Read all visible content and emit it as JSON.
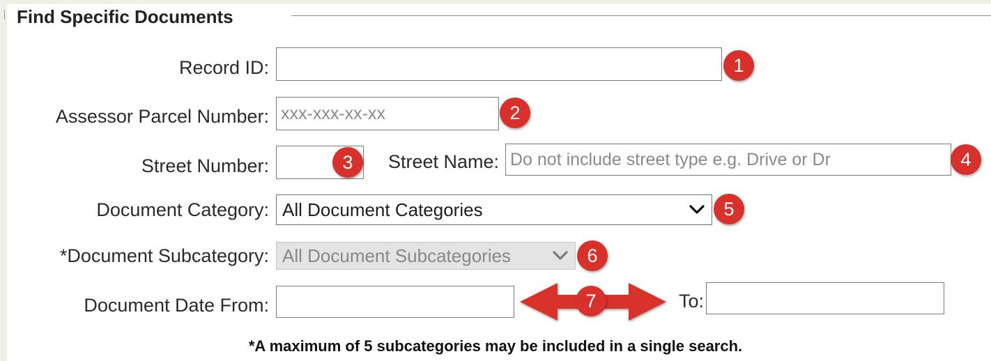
{
  "form": {
    "section_title": "Find Specific Documents",
    "record_id": {
      "label": "Record ID:",
      "value": "",
      "placeholder": ""
    },
    "parcel_number": {
      "label": "Assessor Parcel Number:",
      "value": "",
      "placeholder": "xxx-xxx-xx-xx"
    },
    "street_number": {
      "label": "Street Number:",
      "value": "",
      "placeholder": ""
    },
    "street_name": {
      "label": "Street Name:",
      "value": "",
      "placeholder": "Do not include street type e.g. Drive or Dr"
    },
    "document_category": {
      "label": "Document Category:",
      "selected": "All Document Categories"
    },
    "document_subcategory": {
      "label": "*Document Subcategory:",
      "selected": "All Document Subcategories",
      "disabled": true
    },
    "date_from": {
      "label": "Document Date From:",
      "value": ""
    },
    "date_to": {
      "label": "To:",
      "value": ""
    },
    "note": "*A maximum of 5 subcategories may be included in a single search."
  },
  "annotations": {
    "badges": [
      "1",
      "2",
      "3",
      "4",
      "5",
      "6",
      "7"
    ],
    "badge_color": "#d8312c",
    "arrow_color": "#d8312c",
    "arrow_icon": "double-headed-arrow-icon"
  },
  "colors": {
    "background": "#eef1e4",
    "panel": "#ffffff",
    "disabled_select": "#e4e4e4"
  }
}
